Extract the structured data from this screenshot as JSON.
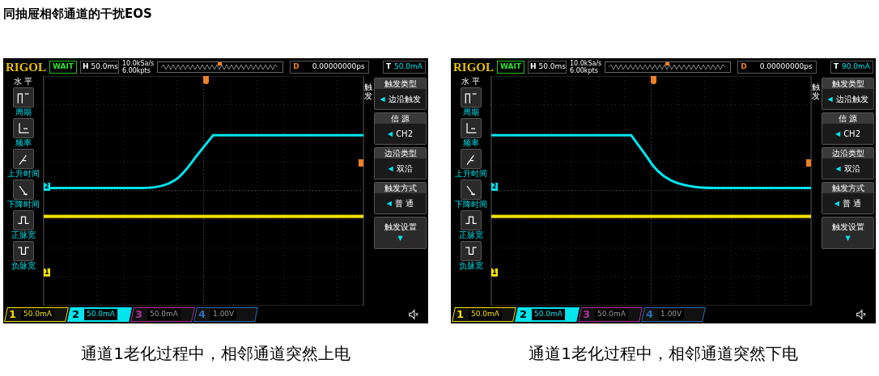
{
  "title": "同抽屉相邻通道的干扰EOS",
  "scopes": [
    {
      "brand": "RIGOL",
      "status": "WAIT",
      "h_label": "H",
      "timebase": "50.0ms",
      "sample_rate": "10.0kSa/s",
      "memory_depth": "6.00kpts",
      "delay_label": "D",
      "delay": "0.00000000ps",
      "trigger_label": "T",
      "trigger_level": "50.0mA",
      "waveform": {
        "kind": "rising"
      },
      "markers": [
        {
          "label": "2",
          "color": "#00e5ee"
        },
        {
          "label": "1",
          "color": "#f0e000"
        }
      ],
      "measure_menu": {
        "title": "水 平",
        "items": [
          {
            "label": "周期",
            "kind": "period"
          },
          {
            "label": "频率",
            "kind": "frequency"
          },
          {
            "label": "上升时间",
            "kind": "rise"
          },
          {
            "label": "下降时间",
            "kind": "fall"
          },
          {
            "label": "正脉宽",
            "kind": "positive"
          },
          {
            "label": "负脉宽",
            "kind": "negative"
          }
        ]
      },
      "trigger_menu": {
        "side_label": "触发",
        "items": [
          {
            "title": "触发类型",
            "arrow": "◀",
            "value": "边沿触发"
          },
          {
            "title": "信 源",
            "arrow": "◀",
            "value": "CH2"
          },
          {
            "title": "边沿类型",
            "arrow": "◀",
            "value": "双沿"
          },
          {
            "title": "触发方式",
            "arrow": "◀",
            "value": "普 通"
          },
          {
            "title": "触发设置",
            "value": "▼"
          }
        ]
      },
      "channels": [
        {
          "number": "1",
          "scale": "50.0mA",
          "color": "#f0e000",
          "selected": false
        },
        {
          "number": "2",
          "scale": "50.0mA",
          "color": "#00e5ee",
          "selected": true
        },
        {
          "number": "3",
          "scale": "50.0mA",
          "color": "#b0309a",
          "selected": false
        },
        {
          "number": "4",
          "scale": "1.00V",
          "color": "#2e6ab0",
          "selected": false
        }
      ],
      "caption": "通道1老化过程中，相邻通道突然上电"
    },
    {
      "brand": "RIGOL",
      "status": "WAIT",
      "h_label": "H",
      "timebase": "50.0ms",
      "sample_rate": "10.0kSa/s",
      "memory_depth": "6.00kpts",
      "delay_label": "D",
      "delay": "0.00000000ps",
      "trigger_label": "T",
      "trigger_level": "90.0mA",
      "waveform": {
        "kind": "falling"
      },
      "markers": [
        {
          "label": "2",
          "color": "#00e5ee"
        },
        {
          "label": "1",
          "color": "#f0e000"
        }
      ],
      "measure_menu": {
        "title": "水 平",
        "items": [
          {
            "label": "周期",
            "kind": "period"
          },
          {
            "label": "频率",
            "kind": "frequency"
          },
          {
            "label": "上升时间",
            "kind": "rise"
          },
          {
            "label": "下降时间",
            "kind": "fall"
          },
          {
            "label": "正脉宽",
            "kind": "positive"
          },
          {
            "label": "负脉宽",
            "kind": "negative"
          }
        ]
      },
      "trigger_menu": {
        "side_label": "触发",
        "items": [
          {
            "title": "触发类型",
            "arrow": "◀",
            "value": "边沿触发"
          },
          {
            "title": "信 源",
            "arrow": "◀",
            "value": "CH2"
          },
          {
            "title": "边沿类型",
            "arrow": "◀",
            "value": "双沿"
          },
          {
            "title": "触发方式",
            "arrow": "◀",
            "value": "普 通"
          },
          {
            "title": "触发设置",
            "value": "▼"
          }
        ]
      },
      "channels": [
        {
          "number": "1",
          "scale": "50.0mA",
          "color": "#f0e000",
          "selected": false
        },
        {
          "number": "2",
          "scale": "50.0mA",
          "color": "#00e5ee",
          "selected": true
        },
        {
          "number": "3",
          "scale": "50.0mA",
          "color": "#b0309a",
          "selected": false
        },
        {
          "number": "4",
          "scale": "1.00V",
          "color": "#2e6ab0",
          "selected": false
        }
      ],
      "caption": "通道1老化过程中，相邻通道突然下电"
    }
  ]
}
